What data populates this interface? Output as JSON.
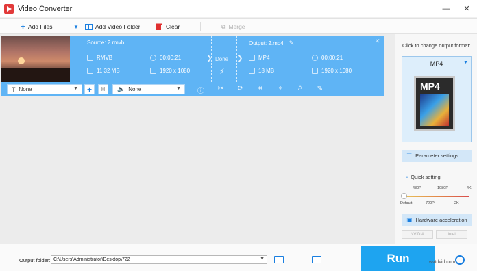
{
  "window": {
    "title": "Video Converter",
    "minimize": "—",
    "close": "✕"
  },
  "toolbar": {
    "add_files": "Add Files",
    "add_folder": "Add Video Folder",
    "clear": "Clear",
    "merge": "Merge"
  },
  "file": {
    "source_label": "Source: 2.rmvb",
    "source_format": "RMVB",
    "source_duration": "00:00:21",
    "source_size": "11.32 MB",
    "source_resolution": "1920 x 1080",
    "status": "Done",
    "output_label": "Output: 2.mp4",
    "output_format": "MP4",
    "output_duration": "00:00:21",
    "output_size": "18 MB",
    "output_resolution": "1920 x 1080"
  },
  "options": {
    "subtitle": "None",
    "audio": "None"
  },
  "right_panel": {
    "title": "Click to change output format:",
    "format": "MP4",
    "format_icon_text": "MP4",
    "parameter_settings": "Parameter settings",
    "quick_setting": "Quick setting",
    "scale_top": [
      "480P",
      "1080P",
      "4K"
    ],
    "scale_bottom": [
      "Default",
      "720P",
      "2K"
    ],
    "hardware_acceleration": "Hardware acceleration",
    "nvidia": "NVIDIA",
    "intel": "Intel"
  },
  "bottom": {
    "output_folder_label": "Output folder:",
    "output_folder_value": "C:\\Users\\Administrator\\Desktop\\722",
    "run": "Run"
  },
  "watermark": "wvtdvid.com",
  "colors": {
    "accent": "#1ea4f0",
    "row_bg": "#5fb4f5",
    "clear_red": "#e03030"
  }
}
